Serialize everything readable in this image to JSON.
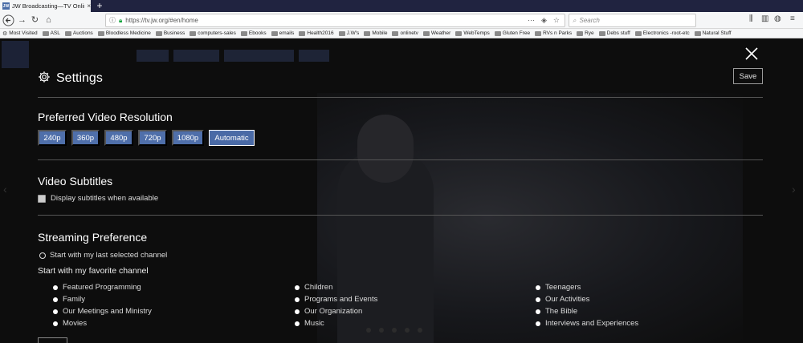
{
  "browser": {
    "tab_title": "JW Broadcasting—TV Online | J",
    "tab_favicon": "JW",
    "url": "https://tv.jw.org/#en/home",
    "search_placeholder": "Search",
    "bookmarks": [
      "Most Visited",
      "ASL",
      "Auctions",
      "Bloodless Medicine",
      "Business",
      "computers-sales",
      "Ebooks",
      "emails",
      "Health2016",
      "J.W's",
      "Mobile",
      "onlinetv",
      "Weather",
      "WebTemps",
      "Gluten Free",
      "RVs n Parks",
      "Rye",
      "Debs stuff",
      "Electronics -root-etc",
      "Natural Stuff"
    ]
  },
  "settings": {
    "title": "Settings",
    "save_label": "Save",
    "resolution": {
      "heading": "Preferred Video Resolution",
      "options": [
        "240p",
        "360p",
        "480p",
        "720p",
        "1080p",
        "Automatic"
      ],
      "selected": "Automatic"
    },
    "subtitles": {
      "heading": "Video Subtitles",
      "checkbox_label": "Display subtitles when available",
      "checked": false
    },
    "streaming": {
      "heading": "Streaming Preference",
      "radio_last": "Start with my last selected channel",
      "favorite_label": "Start with my favorite channel",
      "channels": [
        [
          "Featured Programming",
          "Family",
          "Our Meetings and Ministry",
          "Movies"
        ],
        [
          "Children",
          "Programs and Events",
          "Our Organization",
          "Music"
        ],
        [
          "Teenagers",
          "Our Activities",
          "The Bible",
          "Interviews and Experiences"
        ]
      ]
    }
  },
  "colors": {
    "accent": "#4f6faa",
    "overlay_bg": "#0c0c0c"
  }
}
